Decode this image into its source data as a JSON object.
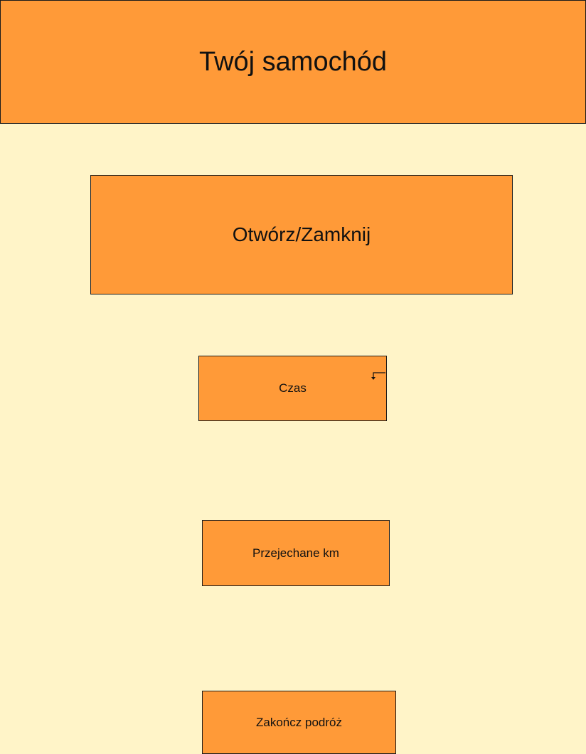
{
  "header": {
    "title": "Twój samochód"
  },
  "controls": {
    "toggle_label": "Otwórz/Zamknij",
    "time_label": "Czas",
    "km_label": "Przejechane km",
    "end_label": "Zakończ podróż"
  },
  "icons": {
    "time_corner": "arrow-down-left-icon"
  },
  "colors": {
    "background": "#FFF4C8",
    "box": "#FF9A38",
    "border": "#1A1A1A"
  }
}
